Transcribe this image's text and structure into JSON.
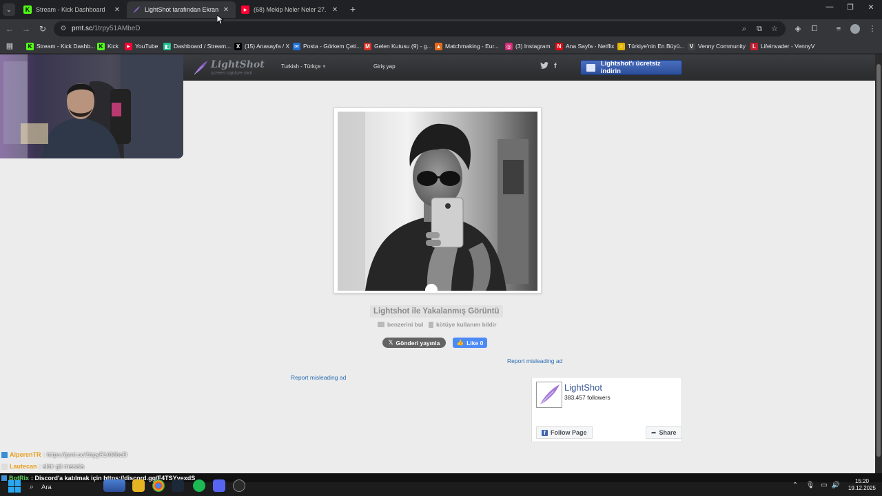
{
  "tabs": [
    {
      "title": "Stream - Kick Dashboard",
      "icon": "K",
      "icon_color": "#53fc18"
    },
    {
      "title": "LightShot tarafından Ekran Gör",
      "icon": "",
      "icon_color": "#8e6bd8"
    },
    {
      "title": "(68) Mekip Neler Neler 27. Bölü",
      "icon": "▶",
      "icon_color": "#ff0033"
    }
  ],
  "toolbar": {
    "url_host": "prnt.sc",
    "url_path": "/1trpy51AMbeD"
  },
  "bookmarks": [
    {
      "label": "Stream - Kick Dashb...",
      "icon": "K",
      "color": "#53fc18"
    },
    {
      "label": "Kick",
      "icon": "K",
      "color": "#53fc18"
    },
    {
      "label": "YouTube",
      "icon": "▶",
      "color": "#ff0033"
    },
    {
      "label": "Dashboard / Stream...",
      "icon": "◧",
      "color": "#1fbd8c"
    },
    {
      "label": "(15) Anasayfa / X",
      "icon": "X",
      "color": "#000000"
    },
    {
      "label": "Posta - Görkem Çeti...",
      "icon": "✉",
      "color": "#1f6fd6"
    },
    {
      "label": "Gelen Kutusu (9) - g...",
      "icon": "M",
      "color": "#d93025"
    },
    {
      "label": "Matchmaking - Eur...",
      "icon": "▲",
      "color": "#e86a1a"
    },
    {
      "label": "(3) Instagram",
      "icon": "◎",
      "color": "#d62976"
    },
    {
      "label": "Ana Sayfa - Netflix",
      "icon": "N",
      "color": "#e50914"
    },
    {
      "label": "Türkiye'nin En Büyü...",
      "icon": "☆",
      "color": "#e2b400"
    },
    {
      "label": "Venny Community",
      "icon": "V",
      "color": "#444444"
    },
    {
      "label": "Lifeinvader - VennyV",
      "icon": "L",
      "color": "#c01f2f"
    }
  ],
  "lightshot": {
    "logo_name": "LightShot",
    "logo_sub": "screen capture tool",
    "language": "Turkish - Türkçe",
    "login": "Giriş yap",
    "download_button": "Lightshot'ı ücretsiz indirin",
    "caption": "Lightshot ile Yakalanmış Görüntü",
    "find_similar": "benzerini bul",
    "report_abuse": "kötüye kullanım bildir",
    "tweet_button": "Gönderi yayınla",
    "like_button": "Like 0",
    "report_ad_1": "Report misleading ad",
    "report_ad_2": "Report misleading ad"
  },
  "facebook_widget": {
    "page_name": "LightShot",
    "followers": "383,457 followers",
    "follow_button": "Follow Page",
    "share_button": "Share"
  },
  "chat": [
    {
      "user": "AlperenTR",
      "sep": ":",
      "message": "https://prnt.sc/1trpy51AMbeD",
      "user_color": "#e6a020"
    },
    {
      "user": "Lautecan",
      "sep": ":",
      "message": "sktir git mesela",
      "user_color": "#e6a020"
    }
  ],
  "taskbar": {
    "notification_user": "BotRix",
    "notification_text": ": Discord'a katılmak için https://discord.gg/F4TSYyexdS",
    "search_label": "Ara",
    "time": "15:20",
    "date": "19.12.2025"
  }
}
